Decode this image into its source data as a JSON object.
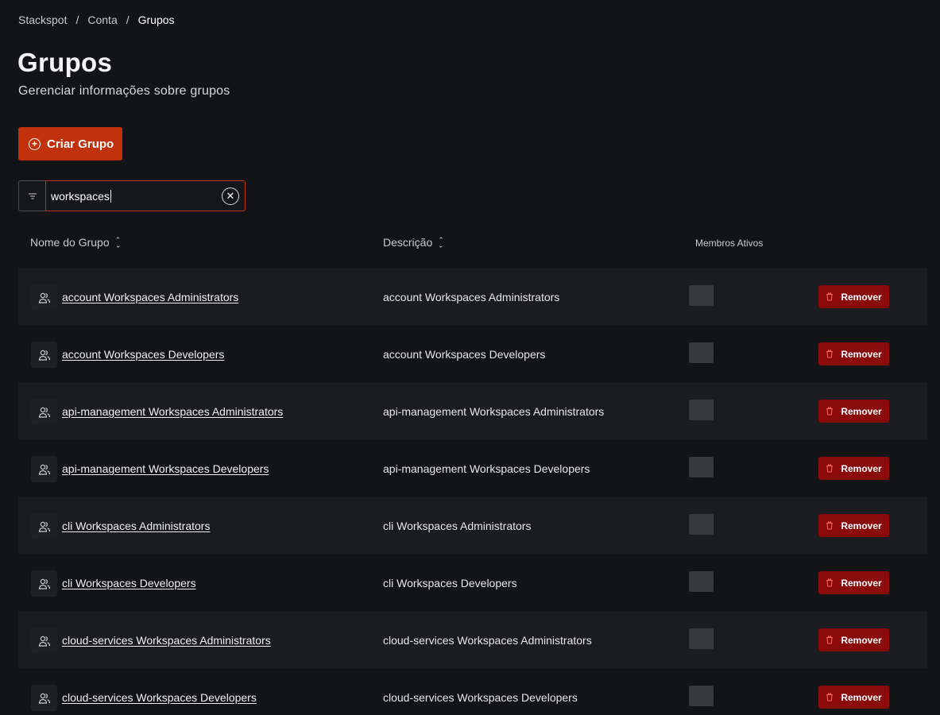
{
  "breadcrumb": {
    "items": [
      "Stackspot",
      "Conta",
      "Grupos"
    ],
    "separator": "/"
  },
  "header": {
    "title": "Grupos",
    "subtitle": "Gerenciar informações sobre grupos"
  },
  "actions": {
    "create_label": "Criar Grupo",
    "create_icon": "plus-circle-icon"
  },
  "filter": {
    "icon": "filter-icon",
    "search_value": "workspaces",
    "clear_icon": "close-circle-icon"
  },
  "table": {
    "columns": {
      "name": "Nome do Grupo",
      "description": "Descrição",
      "members": "Membros Ativos"
    },
    "remove_label": "Remover",
    "rows": [
      {
        "name": "account Workspaces Administrators",
        "description": "account Workspaces Administrators"
      },
      {
        "name": "account Workspaces Developers",
        "description": "account Workspaces Developers"
      },
      {
        "name": "api-management Workspaces Administrators",
        "description": "api-management Workspaces Administrators"
      },
      {
        "name": "api-management Workspaces Developers",
        "description": "api-management Workspaces Developers"
      },
      {
        "name": "cli Workspaces Administrators",
        "description": "cli Workspaces Administrators"
      },
      {
        "name": "cli Workspaces Developers",
        "description": "cli Workspaces Developers"
      },
      {
        "name": "cloud-services Workspaces Administrators",
        "description": "cloud-services Workspaces Administrators"
      },
      {
        "name": "cloud-services Workspaces Developers",
        "description": "cloud-services Workspaces Developers"
      }
    ]
  },
  "colors": {
    "accent": "#c1320c",
    "danger": "#8b0a0a",
    "background": "#131418",
    "row_shade": "#1b1c21"
  }
}
